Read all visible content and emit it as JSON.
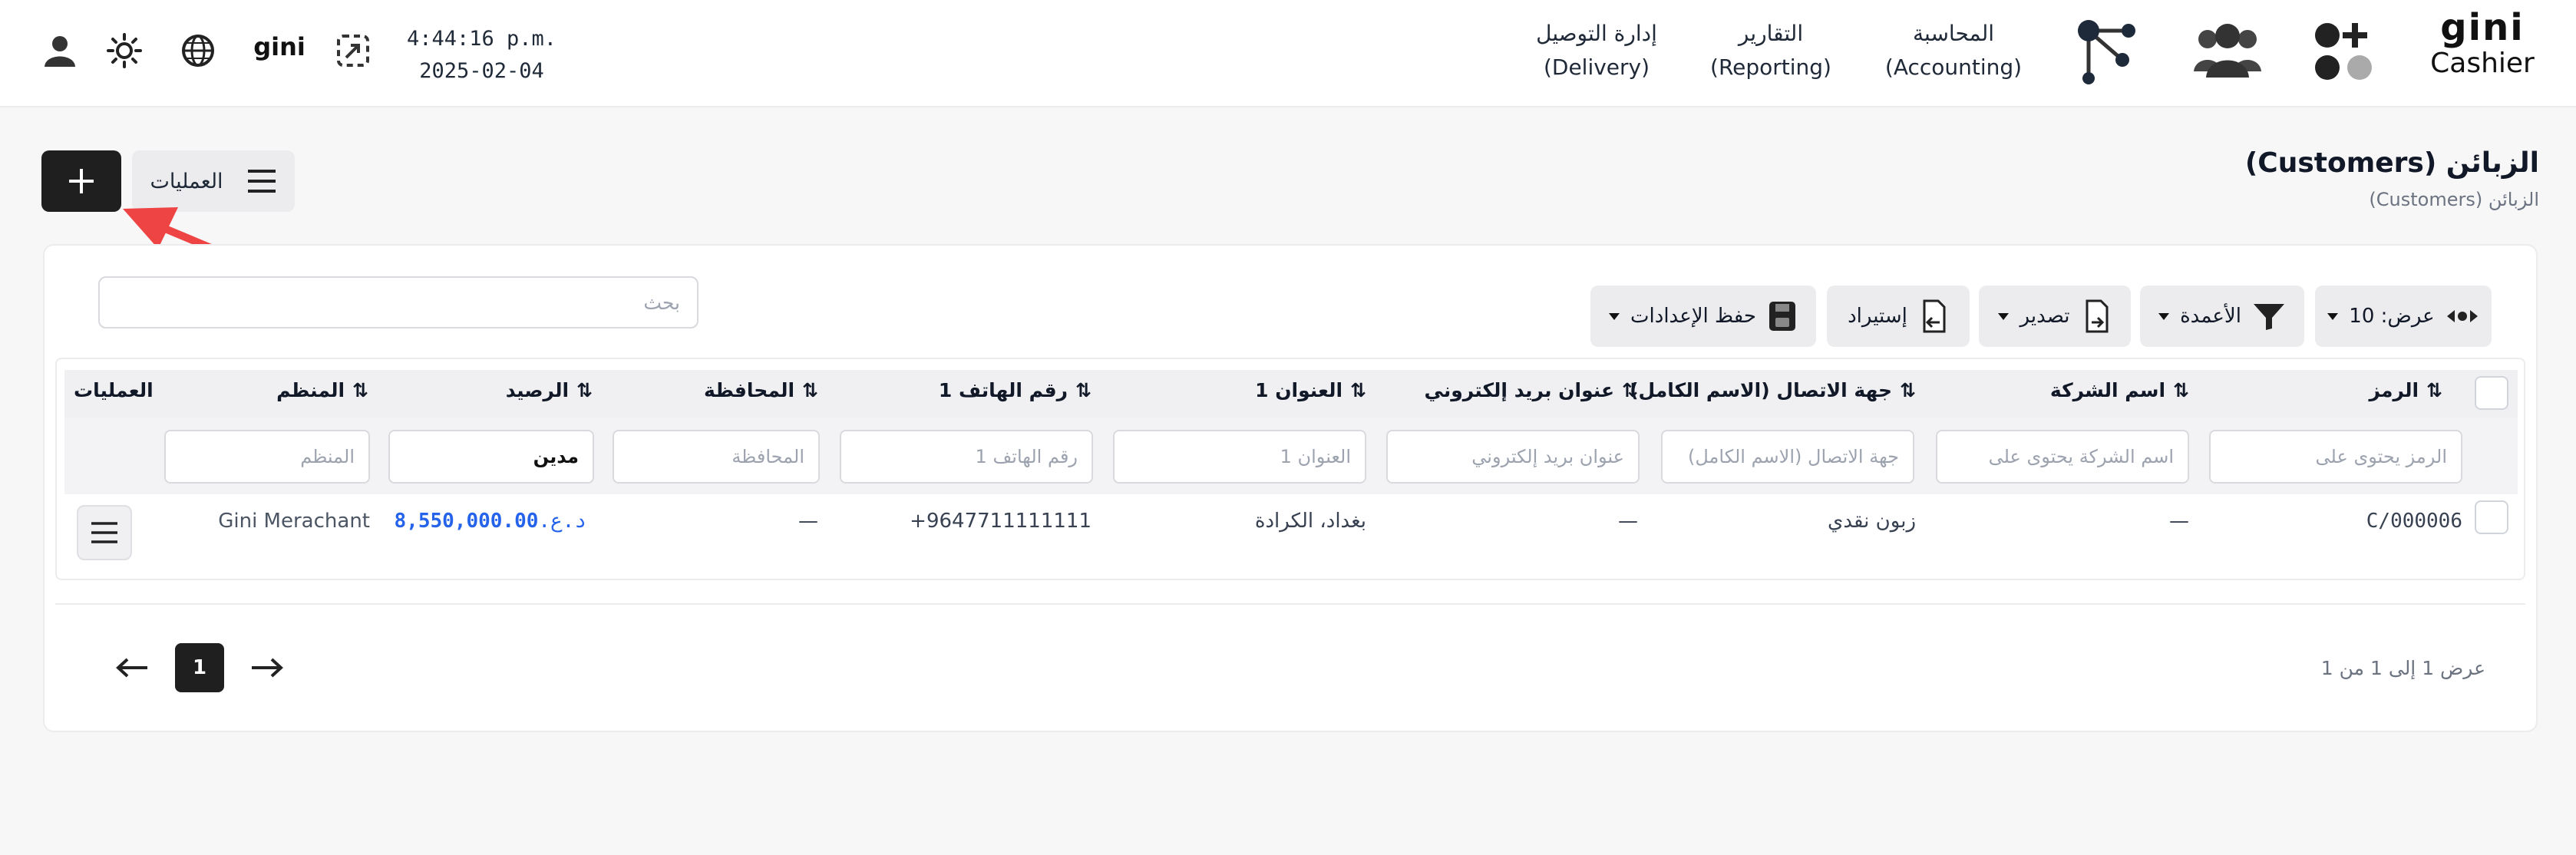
{
  "header": {
    "brand": "Cashier",
    "brand_logo": "gini",
    "nav": [
      {
        "ar": "المحاسبة",
        "en": "(Accounting)"
      },
      {
        "ar": "التقارير",
        "en": "(Reporting)"
      },
      {
        "ar": "إدارة التوصيل",
        "en": "(Delivery)"
      }
    ],
    "time": "4:44:16 p.m.",
    "date": "2025-02-04",
    "small_logo": "gini",
    "icons": [
      "add-apps-icon",
      "users-icon",
      "network-icon",
      "fullscreen-icon",
      "globe-icon",
      "sun-icon",
      "user-icon"
    ]
  },
  "page": {
    "title": "الزبائن (Customers)",
    "breadcrumb": "الزبائن (Customers)",
    "ops_label": "العمليات"
  },
  "toolbar": {
    "show_label": "عرض: 10",
    "columns_label": "الأعمدة",
    "export_label": "تصدير",
    "import_label": "إستيراد",
    "save_label": "حفظ الإعدادات",
    "search_placeholder": "بحث"
  },
  "table": {
    "headers": {
      "code": "الرمز",
      "company": "اسم الشركة",
      "contact": "جهة الاتصال (الاسم الكامل)",
      "email": "عنوان بريد إلكتروني",
      "address": "العنوان 1",
      "phone": "رقم الهاتف 1",
      "province": "المحافظة",
      "balance": "الرصيد",
      "organizer": "المنظم",
      "actions": "العمليات"
    },
    "filters": {
      "code": "الرمز يحتوى على",
      "company": "اسم الشركة يحتوى على",
      "contact": "جهة الاتصال (الاسم الكامل)",
      "email": "عنوان بريد إلكتروني",
      "address": "العنوان 1",
      "phone": "رقم الهاتف 1",
      "province": "المحافظة",
      "balance_value": "مدين",
      "organizer": "المنظم"
    },
    "row": {
      "code": "C/000006",
      "company": "—",
      "contact": "زبون نقدي",
      "email": "—",
      "address": "بغداد، الكرادة",
      "phone": "+9647711111111",
      "province": "—",
      "balance_amount": "8,550,000.00",
      "balance_currency": "د.ع.",
      "organizer": "Gini Merachant"
    }
  },
  "pagination": {
    "current": "1",
    "info": "عرض 1 إلى 1 من 1"
  },
  "colors": {
    "accent_blue": "#2563eb",
    "dark": "#1f1f1f",
    "arrow_red": "#ef4444"
  }
}
